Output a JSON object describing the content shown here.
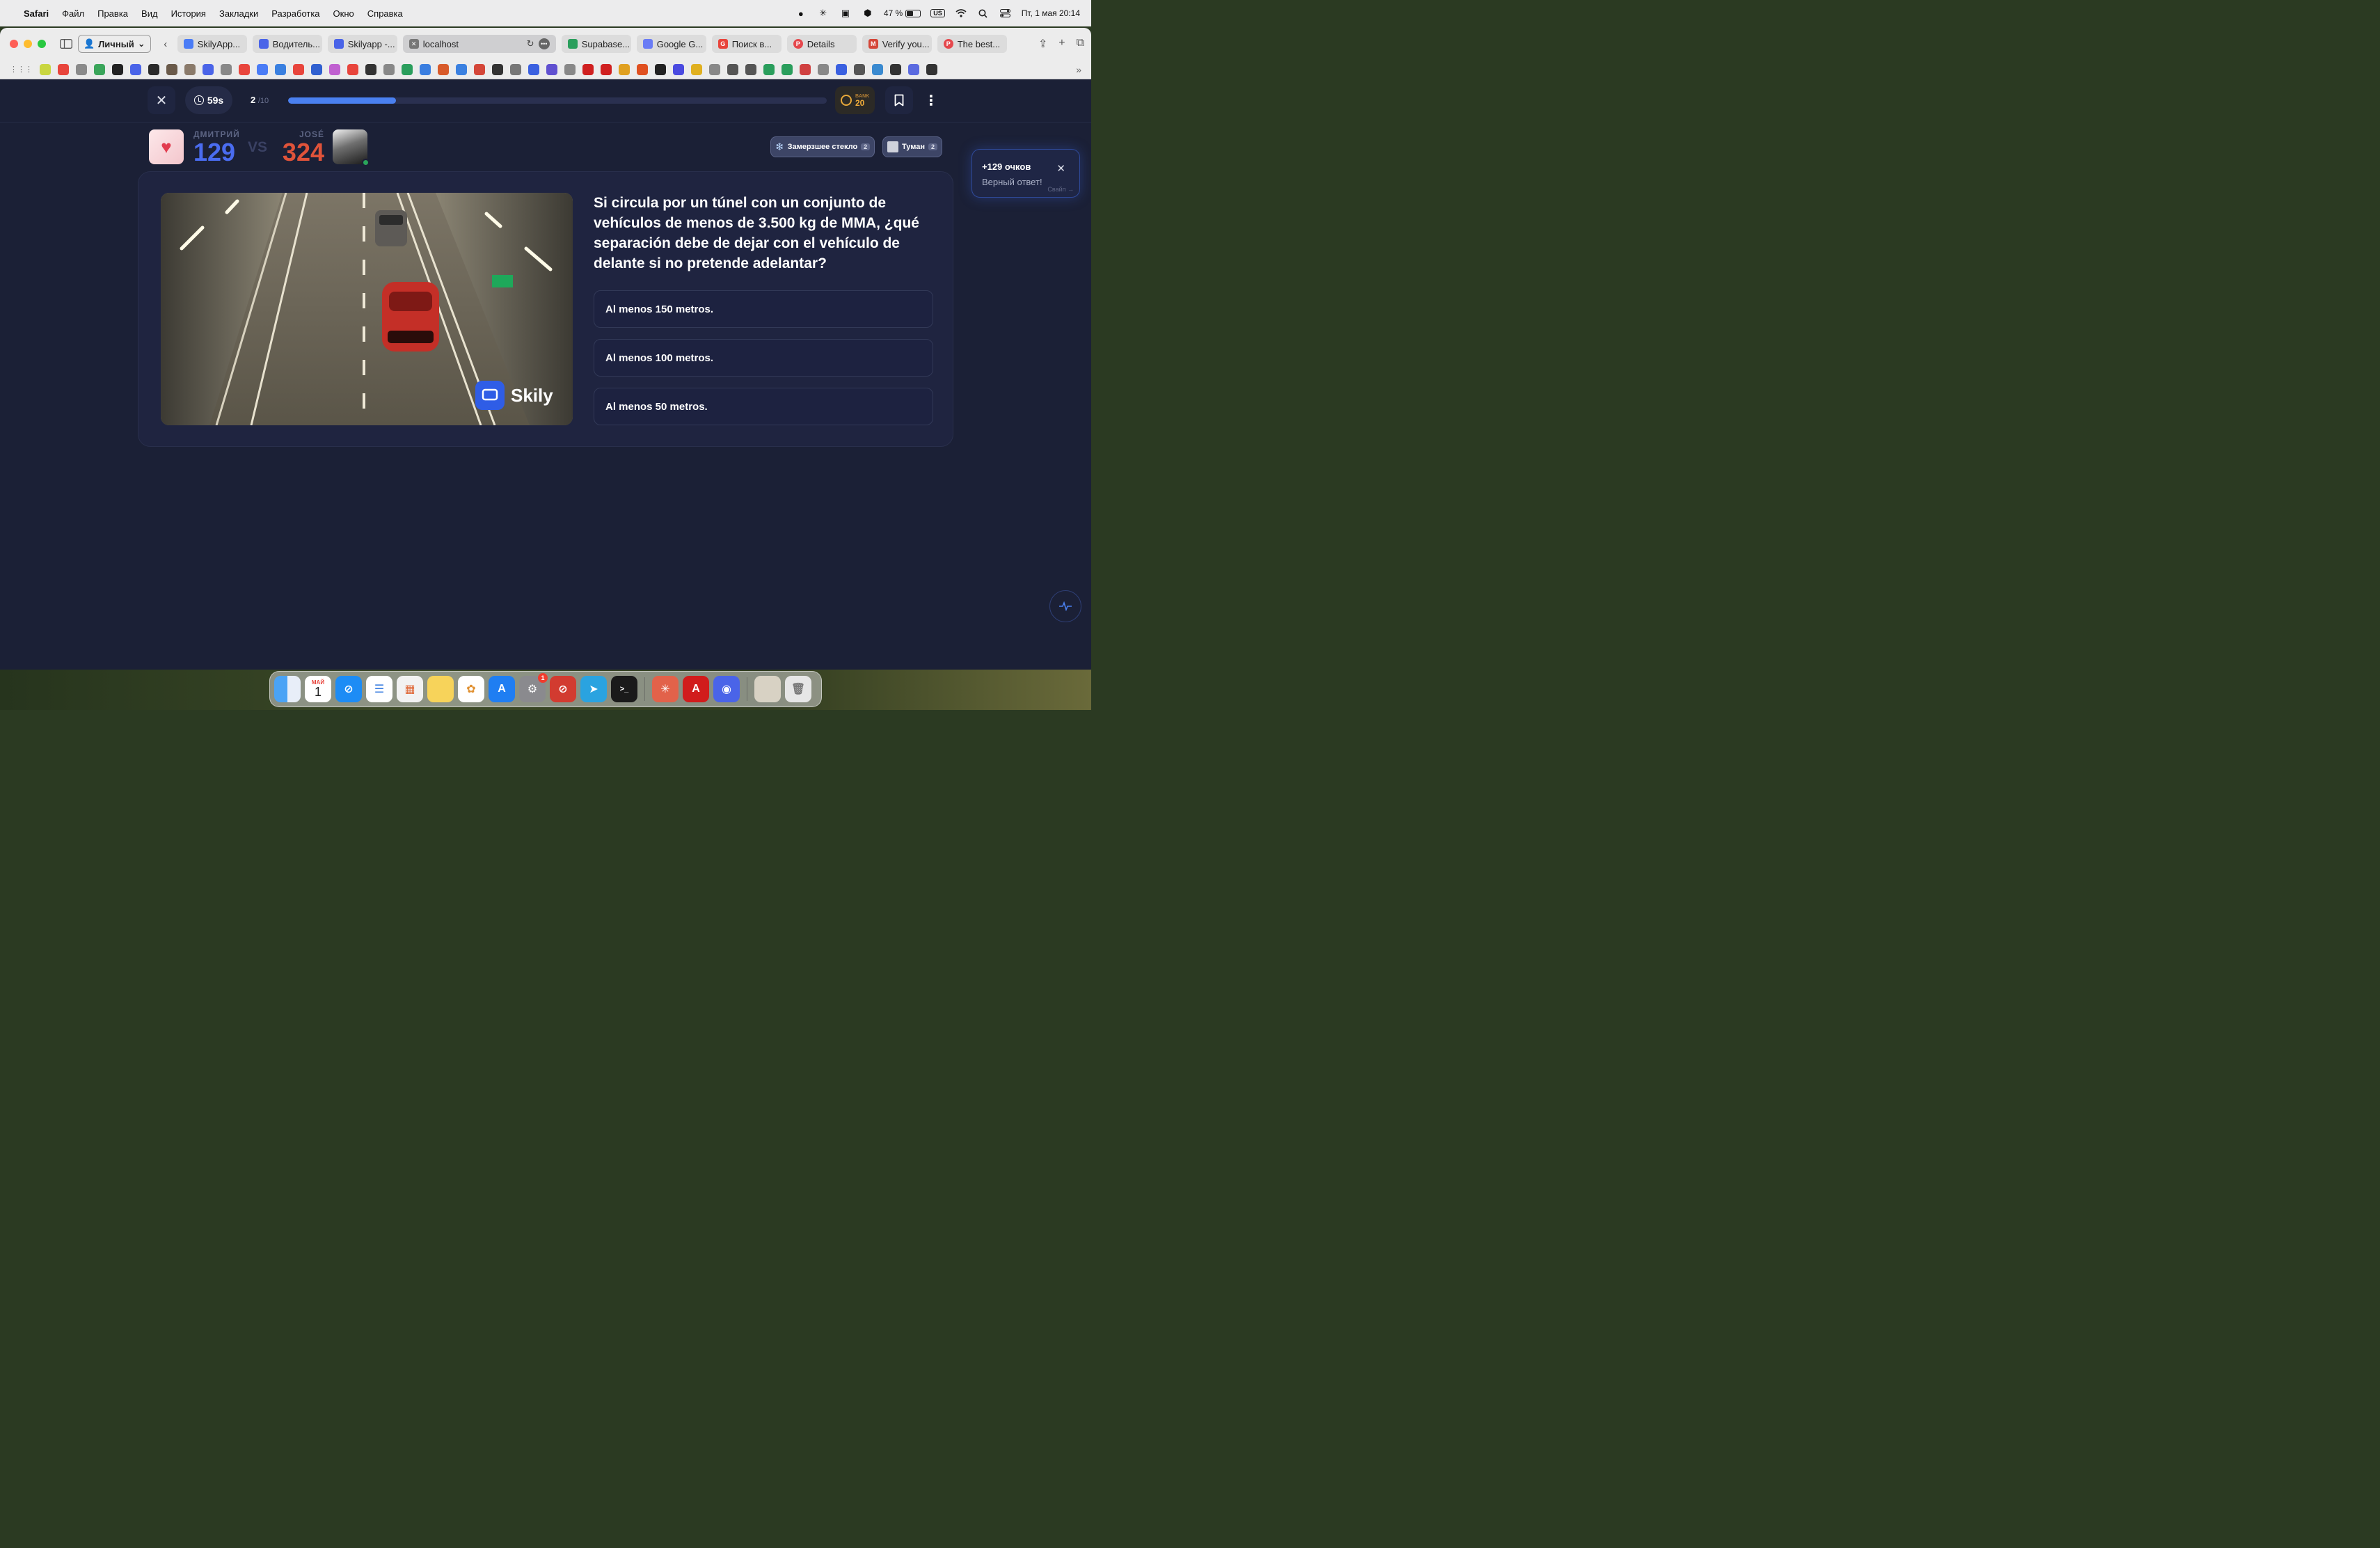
{
  "menubar": {
    "app": "Safari",
    "items": [
      "Файл",
      "Правка",
      "Вид",
      "История",
      "Закладки",
      "Разработка",
      "Окно",
      "Справка"
    ],
    "battery": "47 %",
    "keyboard": "US",
    "datetime": "Пт, 1 мая  20:14"
  },
  "browser": {
    "profile": "Личный",
    "tabs": [
      {
        "label": "SkilyApp...",
        "color": "#4a7cf6"
      },
      {
        "label": "Водитель...",
        "color": "#4a64e8"
      },
      {
        "label": "Skilyapp -...",
        "color": "#4a64e8"
      },
      {
        "label": "localhost",
        "color": "#777777",
        "active": true
      },
      {
        "label": "Supabase...",
        "color": "#2a9e5c"
      },
      {
        "label": "Google G...",
        "color": "#6a7cf5"
      },
      {
        "label": "Поиск в...",
        "color": "#e8453c"
      },
      {
        "label": "Details",
        "color": "#e5484d"
      },
      {
        "label": "Verify you...",
        "color": "#d44638"
      },
      {
        "label": "The best...",
        "color": "#e5484d"
      }
    ],
    "favorite_colors": [
      "#c9d640",
      "#e8453c",
      "#8a8a8a",
      "#3aa55a",
      "#222222",
      "#4a64e8",
      "#2a2a2a",
      "#6a5a4a",
      "#8a7a6a",
      "#4a64e8",
      "#888888",
      "#e8453c",
      "#4a7cf6",
      "#3a80e0",
      "#e8453c",
      "#3060d0",
      "#c060d0",
      "#e8453c",
      "#333333",
      "#888888",
      "#2a9e5c",
      "#3a7ee0",
      "#d85a2a",
      "#3a80e0",
      "#d44638",
      "#333333",
      "#777777",
      "#3a60e0",
      "#6050d0",
      "#888888",
      "#d02020",
      "#d02020",
      "#e0a020",
      "#e05020",
      "#222222",
      "#4a4ae0",
      "#e0b020",
      "#888888",
      "#555555",
      "#555555",
      "#2a9e5c",
      "#2a9e5c",
      "#d04040",
      "#888888",
      "#3a60e0",
      "#555555",
      "#3a8ad0",
      "#333333",
      "#5a6ae0",
      "#333333"
    ]
  },
  "quiz": {
    "close_icon": "✕",
    "timer": "59s",
    "question_index": "2",
    "question_total": "/10",
    "progress_fraction": 0.2,
    "bank_label": "BANK",
    "bank_value": "20",
    "player1": {
      "name": "ДМИТРИЙ",
      "score": "129"
    },
    "vs": "VS",
    "player2": {
      "name": "JOSÉ",
      "score": "324"
    },
    "powerups": [
      {
        "label": "Замерзшее стекло",
        "count": "2"
      },
      {
        "label": "Туман",
        "count": "2"
      }
    ],
    "image_watermark": "Skily",
    "question": "Si circula por un túnel con un conjunto de vehículos de menos de 3.500 kg de MMA, ¿qué separación debe de dejar con el vehículo de delante si no pretende adelantar?",
    "answers": [
      "Al menos 150 metros.",
      "Al menos 100 metros.",
      "Al menos 50 metros."
    ]
  },
  "toast": {
    "title": "+129 очков",
    "subtitle": "Верный ответ!",
    "hint": "Свайп →"
  },
  "dock": {
    "calendar_month": "МАЙ",
    "calendar_day": "1",
    "settings_badge": "1"
  }
}
